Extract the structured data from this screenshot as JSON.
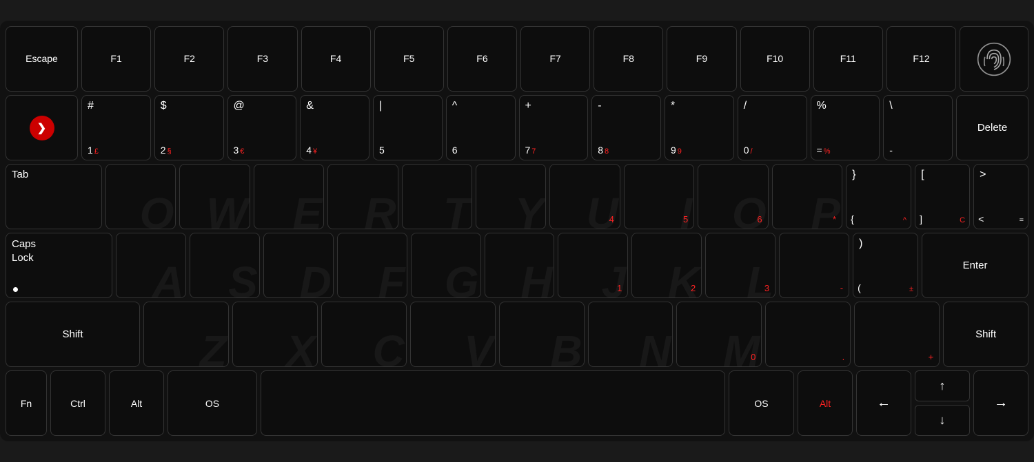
{
  "keyboard": {
    "rows": {
      "row1": {
        "escape": "Escape",
        "f1": "F1",
        "f2": "F2",
        "f3": "F3",
        "f4": "F4",
        "f5": "F5",
        "f6": "F6",
        "f7": "F7",
        "f8": "F8",
        "f9": "F9",
        "f10": "F10",
        "f11": "F11",
        "f12": "F12"
      },
      "row2": {
        "hash_sym": "#",
        "hash_num": "1",
        "hash_red": "£",
        "dollar_sym": "$",
        "dollar_num": "2",
        "dollar_red": "§",
        "at_sym": "@",
        "at_num": "3",
        "at_red": "€",
        "amp_sym": "&",
        "amp_num": "4",
        "amp_red": "¥",
        "pipe_sym": "|",
        "pipe_num": "5",
        "caret_sym": "^",
        "caret_num": "6",
        "plus_sym": "+",
        "plus_num": "7",
        "plus_red": "7",
        "minus_sym": "-",
        "minus_num": "8",
        "minus_red": "8",
        "star_sym": "*",
        "star_num": "9",
        "star_red": "9",
        "slash_sym": "/",
        "slash_num": "0",
        "slash_red": "/",
        "pct_sym": "%",
        "pct_num": "=",
        "pct_red": "%",
        "bslash_sym": "\\",
        "bslash_num": "-",
        "delete": "Delete"
      },
      "row3": {
        "tab": "Tab",
        "numpad4": "4",
        "numpad5": "5",
        "numpad6": "6",
        "numpad_star": "*",
        "brace_r_top": "}",
        "brace_r_bot": "{",
        "brace_r_red": "^",
        "sq_top": "[",
        "sq_bot": "]",
        "sq_red": "C",
        "angle": ">",
        "angle2": "<",
        "angle3": "="
      },
      "row4": {
        "caps": "Caps\nLock",
        "numpad1": "1",
        "numpad2": "2",
        "numpad3": "3",
        "numpad_minus": "-",
        "paren_r_top": ")",
        "paren_r_bot": "(",
        "paren_red": "±",
        "enter": "Enter"
      },
      "row5": {
        "shift_l": "Shift",
        "numpad0": "0",
        "numpad_dot_red": ".",
        "numpad_plus_red": "+",
        "shift_r": "Shift"
      },
      "row6": {
        "fn": "Fn",
        "ctrl": "Ctrl",
        "alt_l": "Alt",
        "os_l": "OS",
        "os_r": "OS",
        "alt_r": "Alt",
        "arrow_left": "←",
        "arrow_up": "↑",
        "arrow_down": "↓",
        "arrow_right": "→"
      }
    }
  }
}
